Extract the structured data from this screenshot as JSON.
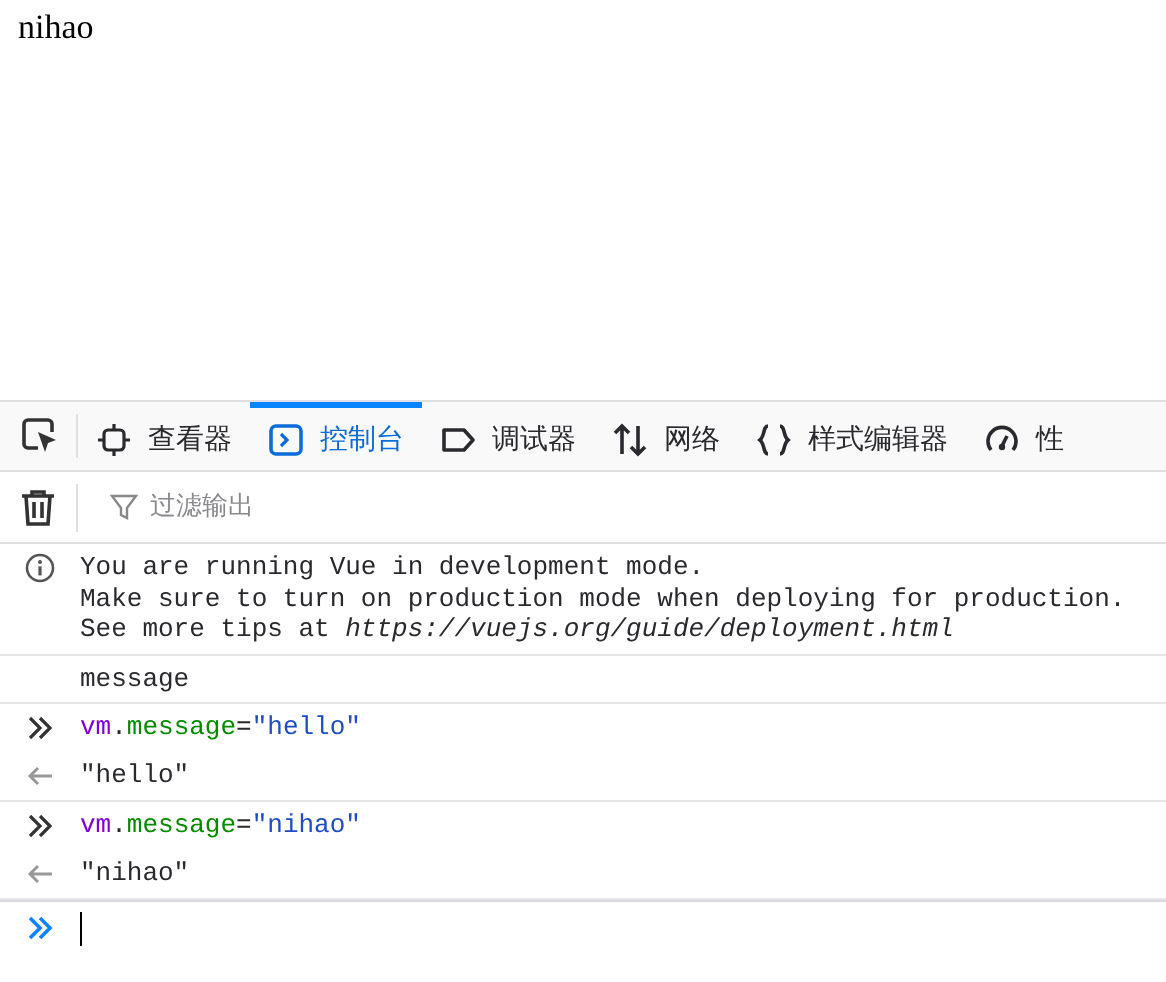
{
  "page": {
    "text": "nihao"
  },
  "devtools": {
    "tabs": [
      {
        "label": "查看器",
        "selected": false
      },
      {
        "label": "控制台",
        "selected": true
      },
      {
        "label": "调试器",
        "selected": false
      },
      {
        "label": "网络",
        "selected": false
      },
      {
        "label": "样式编辑器",
        "selected": false
      },
      {
        "label": "性",
        "selected": false
      }
    ],
    "filter": {
      "placeholder": "过滤输出"
    },
    "console": [
      {
        "kind": "info",
        "lines": [
          "You are running Vue in development mode.",
          "Make sure to turn on production mode when deploying for production.",
          "See more tips at *https://vuejs.org/guide/deployment.html*"
        ]
      },
      {
        "kind": "log",
        "text": "message"
      },
      {
        "kind": "input",
        "tokens": [
          {
            "text": "vm",
            "kind": "variable"
          },
          {
            "text": ".",
            "kind": "punct"
          },
          {
            "text": "message",
            "kind": "property"
          },
          {
            "text": "=",
            "kind": "punct"
          },
          {
            "text": "\"hello\"",
            "kind": "string"
          }
        ]
      },
      {
        "kind": "result",
        "text": "\"hello\""
      },
      {
        "kind": "input",
        "tokens": [
          {
            "text": "vm",
            "kind": "variable"
          },
          {
            "text": ".",
            "kind": "punct"
          },
          {
            "text": "message",
            "kind": "property"
          },
          {
            "text": "=",
            "kind": "punct"
          },
          {
            "text": "\"nihao\"",
            "kind": "string"
          }
        ]
      },
      {
        "kind": "result",
        "text": "\"nihao\""
      }
    ]
  }
}
